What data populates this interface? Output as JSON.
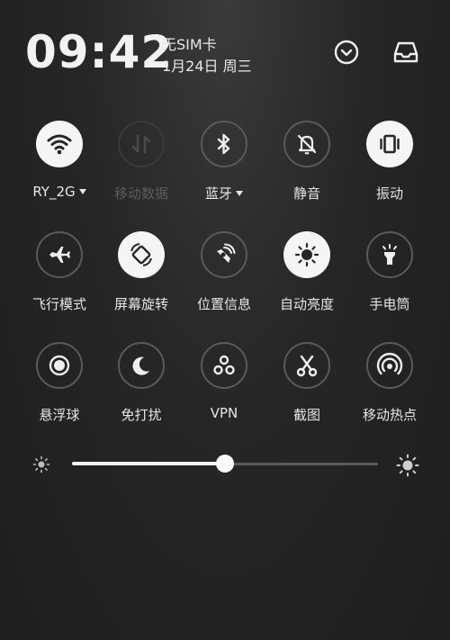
{
  "header": {
    "time": "09:42",
    "sim": "无SIM卡",
    "date": "1月24日 周三"
  },
  "tiles": [
    {
      "label": "RY_2G",
      "icon": "wifi-icon",
      "state": "on",
      "dropdown": true
    },
    {
      "label": "移动数据",
      "icon": "mobile-data-icon",
      "state": "disabled",
      "dropdown": false
    },
    {
      "label": "蓝牙",
      "icon": "bluetooth-icon",
      "state": "off",
      "dropdown": true
    },
    {
      "label": "静音",
      "icon": "mute-icon",
      "state": "off",
      "dropdown": false
    },
    {
      "label": "振动",
      "icon": "vibrate-icon",
      "state": "on",
      "dropdown": false
    },
    {
      "label": "飞行模式",
      "icon": "airplane-icon",
      "state": "off",
      "dropdown": false
    },
    {
      "label": "屏幕旋转",
      "icon": "rotate-icon",
      "state": "on",
      "dropdown": false
    },
    {
      "label": "位置信息",
      "icon": "location-icon",
      "state": "off",
      "dropdown": false
    },
    {
      "label": "自动亮度",
      "icon": "auto-brightness-icon",
      "state": "on",
      "dropdown": false
    },
    {
      "label": "手电筒",
      "icon": "flashlight-icon",
      "state": "off",
      "dropdown": false
    },
    {
      "label": "悬浮球",
      "icon": "floating-ball-icon",
      "state": "off",
      "dropdown": false
    },
    {
      "label": "免打扰",
      "icon": "moon-icon",
      "state": "off",
      "dropdown": false
    },
    {
      "label": "VPN",
      "icon": "vpn-icon",
      "state": "off",
      "dropdown": false
    },
    {
      "label": "截图",
      "icon": "scissors-icon",
      "state": "off",
      "dropdown": false
    },
    {
      "label": "移动热点",
      "icon": "hotspot-icon",
      "state": "off",
      "dropdown": false
    }
  ],
  "brightness": {
    "level": 0.5
  },
  "colors": {
    "accent": "#f5f5f5",
    "background": "#262626",
    "inactive_ring": "#5a5a5a"
  }
}
